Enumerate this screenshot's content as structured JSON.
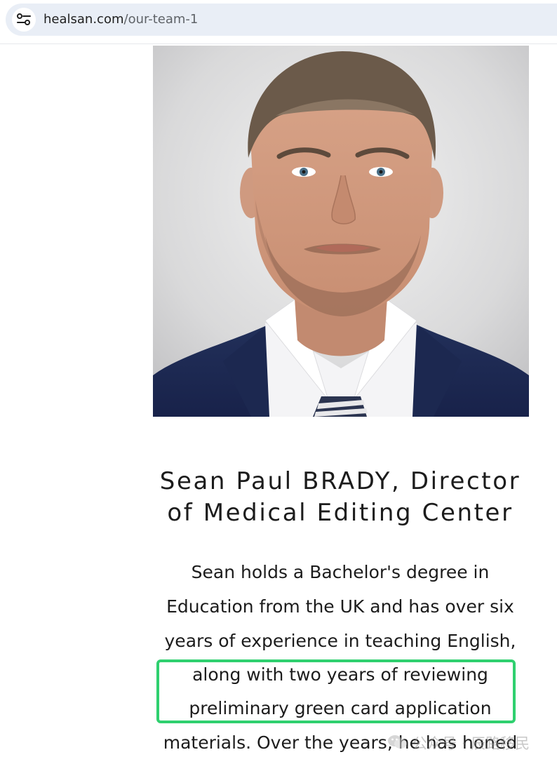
{
  "browser": {
    "url_host": "healsan.com",
    "url_path": "/our-team-1",
    "site_info_icon": "tune-icon"
  },
  "profile": {
    "photo_icon": "portrait-photo",
    "heading_line1": "Sean Paul BRADY, Director",
    "heading_line2": "of Medical Editing Center",
    "bio_lines": [
      "Sean holds a Bachelor's degree in",
      "Education from the UK and has over six",
      "years of experience in teaching English,",
      "along with two years of reviewing",
      "preliminary green card application",
      "materials. Over the years, he has honed"
    ]
  },
  "highlight": {
    "color": "#2fd06f"
  },
  "watermark": {
    "text": "公众号 · 辰路移民",
    "icon": "wechat-icon"
  }
}
